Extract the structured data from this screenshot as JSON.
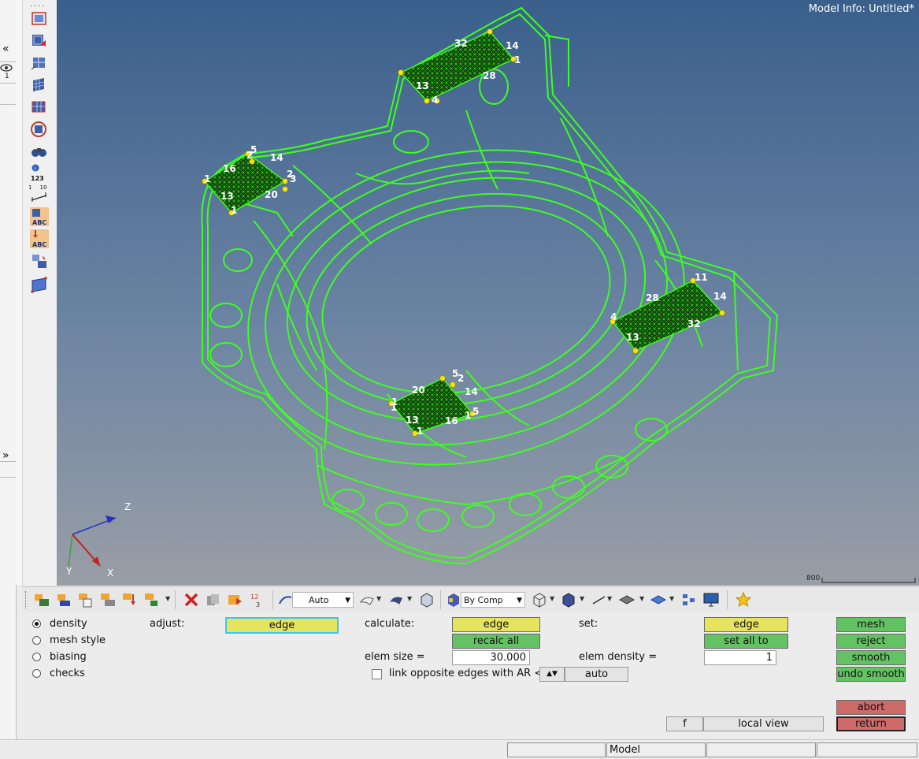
{
  "viewport": {
    "model_info": "Model Info: Untitled*",
    "scale_label": "800",
    "axis": {
      "z": "Z",
      "y": "Y",
      "x": "X"
    },
    "mesh_labels": {
      "patch_top": [
        "32",
        "14",
        "1",
        "28",
        "13",
        "4"
      ],
      "patch_left": [
        "5",
        "2",
        "14",
        "16",
        "1",
        "2",
        "3",
        "13",
        "20",
        "1"
      ],
      "patch_right": [
        "11",
        "28",
        "14",
        "4",
        "32",
        "13"
      ],
      "patch_bottom": [
        "5",
        "2",
        "1",
        "20",
        "14",
        "1",
        "13",
        "16",
        "5",
        "1",
        "1"
      ]
    },
    "colors": {
      "mesh_green": "#3cff1f",
      "vertex_yellow": "#f3e313",
      "bg_top": "#3a5f8c",
      "bg_bottom": "#999ea6"
    }
  },
  "lefttoolbar": {
    "icons": [
      "fit-icon",
      "tiles-icon",
      "mirror-mesh-icon",
      "mesh-grid-icon",
      "mesh-sheet-icon",
      "element-check-icon",
      "binoculars-icon",
      "id-number-icon",
      "ruler-icon",
      "abc-label-icon",
      "abc-label-down-icon",
      "transform-icon",
      "plane-icon"
    ],
    "id_label": "123",
    "ruler_marks": "1 10",
    "strip_marks": [
      "«",
      "1",
      "»"
    ]
  },
  "bottomtoolbar": {
    "auto_label": "Auto",
    "bycomp_label": "By Comp"
  },
  "panel": {
    "radios": [
      {
        "label": "density",
        "selected": true
      },
      {
        "label": "mesh style",
        "selected": false
      },
      {
        "label": "biasing",
        "selected": false
      },
      {
        "label": "checks",
        "selected": false
      }
    ],
    "adjust_label": "adjust:",
    "adjust_value": "edge",
    "calculate_label": "calculate:",
    "calculate_value": "edge",
    "recalc_all": "recalc all",
    "elem_size_label": "elem size =",
    "elem_size_value": "30.000",
    "link_label": "link opposite edges with AR <",
    "auto_button": "auto",
    "set_label": "set:",
    "set_value": "edge",
    "set_all_to": "set all to",
    "elem_density_label": "elem density =",
    "elem_density_value": "1",
    "mesh": "mesh",
    "reject": "reject",
    "smooth": "smooth",
    "undo_smooth": "undo smooth",
    "abort": "abort",
    "return": "return",
    "f_button": "f",
    "local_view": "local view"
  },
  "statusbar": {
    "model": "Model"
  }
}
